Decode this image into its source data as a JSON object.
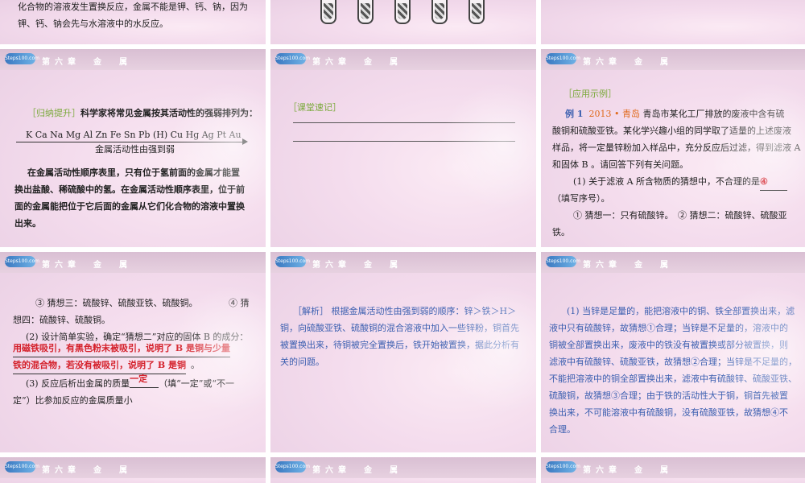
{
  "header": {
    "logo": "Steps100.com",
    "chapter": "第六章　金　属"
  },
  "slide1": {
    "line1": "化合物的溶液发生置换反应，金属不能是钾、钙、钠，因为",
    "line2": "钾、钙、钠会先与水溶液中的水反应。"
  },
  "slide4": {
    "tag": "［归纳提升］",
    "intro": "科学家将常见金属按其活动性的强弱排列为：",
    "series": "K  Ca  Na  Mg  Al  Zn  Fe  Sn  Pb  (H)  Cu  Hg  Ag  Pt  Au",
    "arrow_caption": "金属活动性由强到弱",
    "para_lines": [
      "在金属活动性顺序表里，只有位于氢前面的金属才能置",
      "换出盐酸、稀硫酸中的氢。在金属活动性顺序表里，位于前",
      "面的金属能把位于它后面的金属从它们化合物的溶液中置换",
      "出来。"
    ]
  },
  "slide5": {
    "tag": "［课堂速记］"
  },
  "slide6": {
    "tag": "［应用示例］",
    "ex_label": "例 1",
    "ex_year": "2013 • 青岛",
    "line1": "青岛市某化工厂排放的废液中含有硫",
    "line2": "酸铜和硫酸亚铁。某化学兴趣小组的同学取了适量的上述废液",
    "line3": "样品，将一定量锌粉加入样品中，充分反应后过滤，得到滤液 A",
    "line4": "和固体 B 。请回答下列有关问题。",
    "q1": "(1) 关于滤液 A 所含物质的猜想中，不合理的是",
    "q1_answer": "④",
    "q1_tail": "（填写序号）。",
    "guess12": "① 猜想一：只有硫酸锌。　② 猜想二：硫酸锌、硫酸亚",
    "guess12b": "铁。"
  },
  "slide7": {
    "guess3": "③ 猜想三：硫酸锌、硫酸亚铁、硫酸铜。　　　　④ 猜",
    "guess4": "想四：硫酸锌、硫酸铜。",
    "q2": "(2) 设计简单实验，确定“猜想二”对应的固体 B 的成分：",
    "ans2_line1": "用磁铁吸引，有黑色粉末被吸引，说明了 B 是铜与少量",
    "ans2_line2": "铁的混合物，若没有被吸引，说明了 B 是铜",
    "ans2_end": "。",
    "q3a": "(3) 反应后析出金属的质量",
    "q3_answer": "一定",
    "q3b": "（填“一定”或“不一",
    "q3c": "定”）比参加反应的金属质量小"
  },
  "slide8": {
    "tag": "［解析］",
    "lines": [
      "根据金属活动性由强到弱的顺序：锌＞铁＞H＞",
      "铜，向硫酸亚铁、硫酸铜的混合溶液中加入一些锌粉，铜首先",
      "被置换出来，待铜被完全置换后，铁开始被置换，据此分析有",
      "关的问题。"
    ]
  },
  "slide9": {
    "lines": [
      "(1) 当锌是足量的，能把溶液中的铜、铁全部置换出来，滤",
      "液中只有硫酸锌，故猜想①合理；当锌是不足量的，溶液中的",
      "铜被全部置换出来，废液中的铁没有被置换或部分被置换，则",
      "滤液中有硫酸锌、硫酸亚铁，故猜想②合理；当锌是不足量的，",
      "不能把溶液中的铜全部置换出来，滤液中有硫酸锌、硫酸亚铁、",
      "硫酸铜，故猜想③合理；由于铁的活动性大于铜，铜首先被置",
      "换出来，不可能溶液中有硫酸铜，没有硫酸亚铁，故猜想④不",
      "合理。"
    ]
  },
  "colors": {
    "tag_green": "#7aa93a",
    "analysis_blue": "#3b5fb0",
    "answer_red": "#d4202a",
    "example_orange": "#e06a1c"
  }
}
